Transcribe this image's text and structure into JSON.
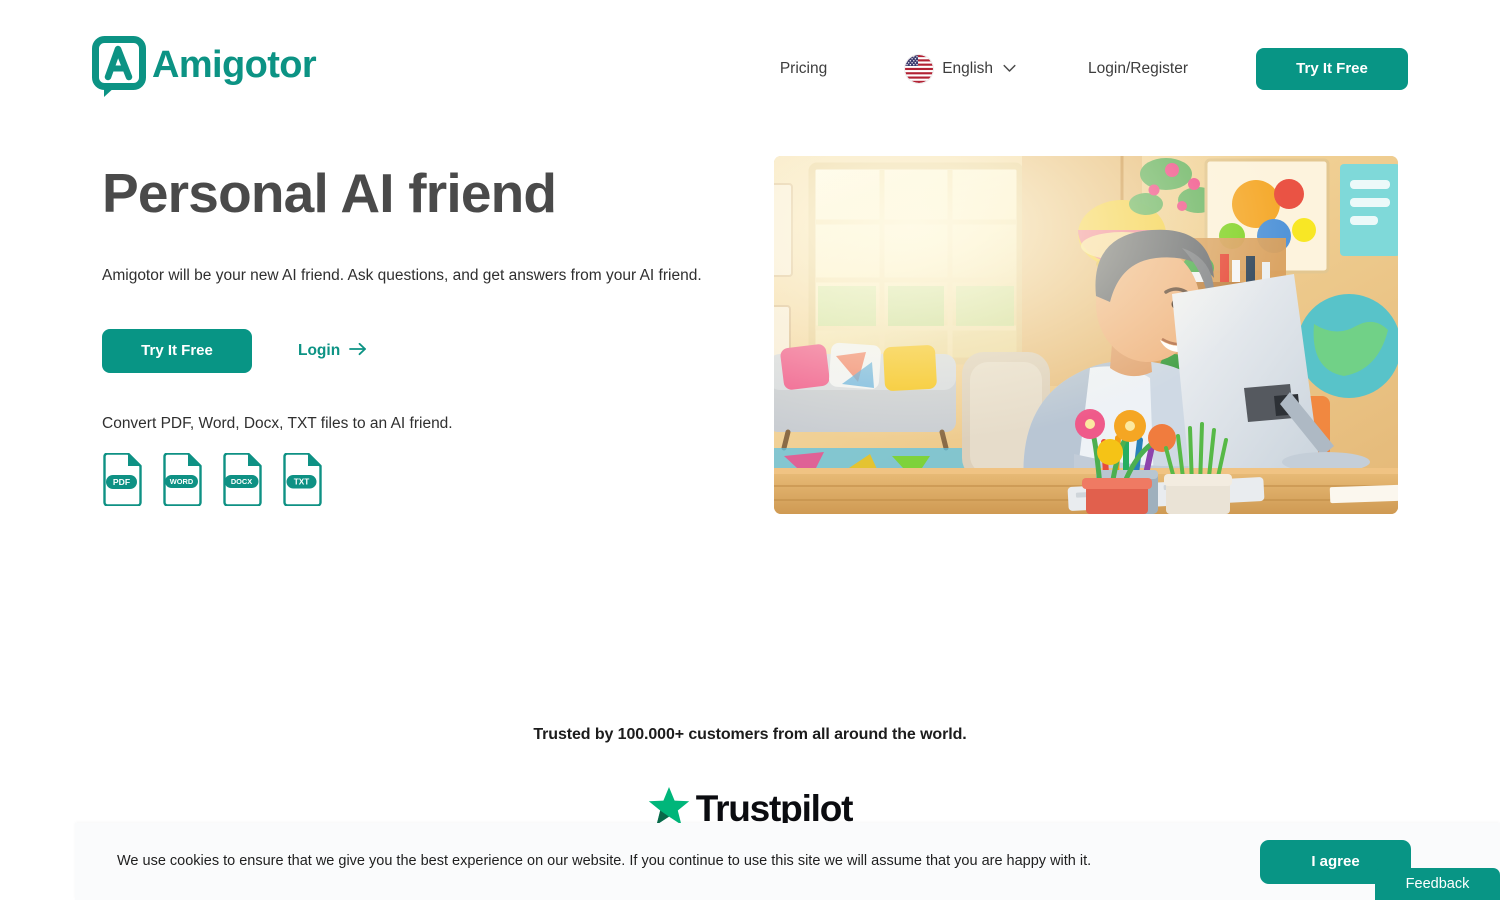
{
  "brand": {
    "name": "Amigotor",
    "logo_letter": "A",
    "color": "#0C9384"
  },
  "header": {
    "nav": {
      "pricing": "Pricing",
      "language": "English",
      "language_flag": "us-flag-icon",
      "login_register": "Login/Register",
      "cta": "Try It Free"
    }
  },
  "hero": {
    "title": "Personal AI friend",
    "subtitle": "Amigotor will be your new AI friend. Ask questions, and get answers from your AI friend.",
    "primary_cta": "Try It Free",
    "login_link": "Login",
    "convert_text": "Convert PDF, Word, Docx, TXT files to an AI friend.",
    "file_types": [
      {
        "label": "PDF"
      },
      {
        "label": "WORD"
      },
      {
        "label": "DOCX"
      },
      {
        "label": "TXT"
      }
    ],
    "image_alt": "Smiling man working at a desktop computer in a colorful sunlit home office"
  },
  "trust": {
    "headline": "Trusted by 100.000+ customers from all around the world.",
    "trustpilot_label": "Trustpilot",
    "trustpilot_color": "#00B67A"
  },
  "cookie_banner": {
    "message": "We use cookies to ensure that we give you the best experience on our website. If you continue to use this site we will assume that you are happy with it.",
    "agree_label": "I agree"
  },
  "feedback": {
    "label": "Feedback"
  },
  "theme": {
    "accent": "#089585",
    "accent_dark": "#0C9384",
    "heading": "#4a4a4a",
    "body": "#2f2f2f",
    "banner_bg": "#fafbfc"
  }
}
